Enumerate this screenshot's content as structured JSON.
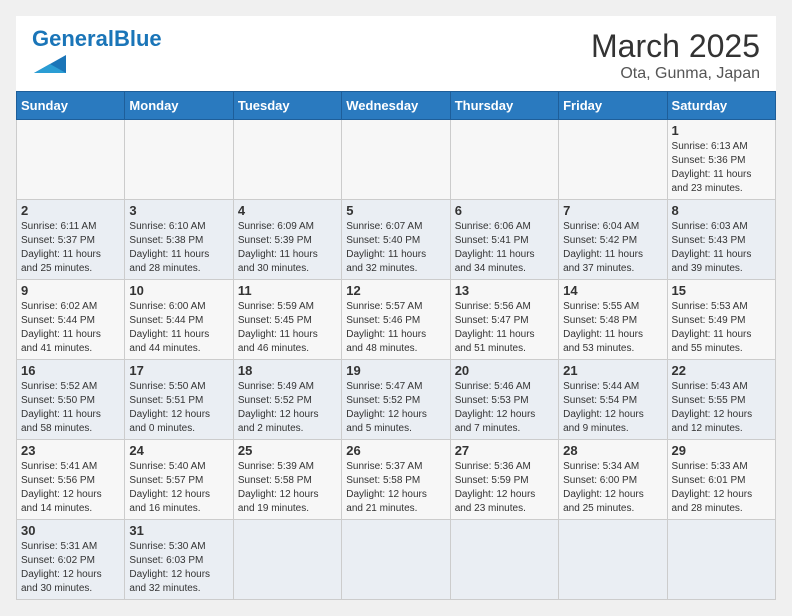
{
  "header": {
    "logo_general": "General",
    "logo_blue": "Blue",
    "month_year": "March 2025",
    "location": "Ota, Gunma, Japan"
  },
  "weekdays": [
    "Sunday",
    "Monday",
    "Tuesday",
    "Wednesday",
    "Thursday",
    "Friday",
    "Saturday"
  ],
  "days": [
    {
      "date": "",
      "info": ""
    },
    {
      "date": "",
      "info": ""
    },
    {
      "date": "",
      "info": ""
    },
    {
      "date": "",
      "info": ""
    },
    {
      "date": "",
      "info": ""
    },
    {
      "date": "",
      "info": ""
    },
    {
      "date": "1",
      "info": "Sunrise: 6:13 AM\nSunset: 5:36 PM\nDaylight: 11 hours\nand 23 minutes."
    },
    {
      "date": "2",
      "info": "Sunrise: 6:11 AM\nSunset: 5:37 PM\nDaylight: 11 hours\nand 25 minutes."
    },
    {
      "date": "3",
      "info": "Sunrise: 6:10 AM\nSunset: 5:38 PM\nDaylight: 11 hours\nand 28 minutes."
    },
    {
      "date": "4",
      "info": "Sunrise: 6:09 AM\nSunset: 5:39 PM\nDaylight: 11 hours\nand 30 minutes."
    },
    {
      "date": "5",
      "info": "Sunrise: 6:07 AM\nSunset: 5:40 PM\nDaylight: 11 hours\nand 32 minutes."
    },
    {
      "date": "6",
      "info": "Sunrise: 6:06 AM\nSunset: 5:41 PM\nDaylight: 11 hours\nand 34 minutes."
    },
    {
      "date": "7",
      "info": "Sunrise: 6:04 AM\nSunset: 5:42 PM\nDaylight: 11 hours\nand 37 minutes."
    },
    {
      "date": "8",
      "info": "Sunrise: 6:03 AM\nSunset: 5:43 PM\nDaylight: 11 hours\nand 39 minutes."
    },
    {
      "date": "9",
      "info": "Sunrise: 6:02 AM\nSunset: 5:44 PM\nDaylight: 11 hours\nand 41 minutes."
    },
    {
      "date": "10",
      "info": "Sunrise: 6:00 AM\nSunset: 5:44 PM\nDaylight: 11 hours\nand 44 minutes."
    },
    {
      "date": "11",
      "info": "Sunrise: 5:59 AM\nSunset: 5:45 PM\nDaylight: 11 hours\nand 46 minutes."
    },
    {
      "date": "12",
      "info": "Sunrise: 5:57 AM\nSunset: 5:46 PM\nDaylight: 11 hours\nand 48 minutes."
    },
    {
      "date": "13",
      "info": "Sunrise: 5:56 AM\nSunset: 5:47 PM\nDaylight: 11 hours\nand 51 minutes."
    },
    {
      "date": "14",
      "info": "Sunrise: 5:55 AM\nSunset: 5:48 PM\nDaylight: 11 hours\nand 53 minutes."
    },
    {
      "date": "15",
      "info": "Sunrise: 5:53 AM\nSunset: 5:49 PM\nDaylight: 11 hours\nand 55 minutes."
    },
    {
      "date": "16",
      "info": "Sunrise: 5:52 AM\nSunset: 5:50 PM\nDaylight: 11 hours\nand 58 minutes."
    },
    {
      "date": "17",
      "info": "Sunrise: 5:50 AM\nSunset: 5:51 PM\nDaylight: 12 hours\nand 0 minutes."
    },
    {
      "date": "18",
      "info": "Sunrise: 5:49 AM\nSunset: 5:52 PM\nDaylight: 12 hours\nand 2 minutes."
    },
    {
      "date": "19",
      "info": "Sunrise: 5:47 AM\nSunset: 5:52 PM\nDaylight: 12 hours\nand 5 minutes."
    },
    {
      "date": "20",
      "info": "Sunrise: 5:46 AM\nSunset: 5:53 PM\nDaylight: 12 hours\nand 7 minutes."
    },
    {
      "date": "21",
      "info": "Sunrise: 5:44 AM\nSunset: 5:54 PM\nDaylight: 12 hours\nand 9 minutes."
    },
    {
      "date": "22",
      "info": "Sunrise: 5:43 AM\nSunset: 5:55 PM\nDaylight: 12 hours\nand 12 minutes."
    },
    {
      "date": "23",
      "info": "Sunrise: 5:41 AM\nSunset: 5:56 PM\nDaylight: 12 hours\nand 14 minutes."
    },
    {
      "date": "24",
      "info": "Sunrise: 5:40 AM\nSunset: 5:57 PM\nDaylight: 12 hours\nand 16 minutes."
    },
    {
      "date": "25",
      "info": "Sunrise: 5:39 AM\nSunset: 5:58 PM\nDaylight: 12 hours\nand 19 minutes."
    },
    {
      "date": "26",
      "info": "Sunrise: 5:37 AM\nSunset: 5:58 PM\nDaylight: 12 hours\nand 21 minutes."
    },
    {
      "date": "27",
      "info": "Sunrise: 5:36 AM\nSunset: 5:59 PM\nDaylight: 12 hours\nand 23 minutes."
    },
    {
      "date": "28",
      "info": "Sunrise: 5:34 AM\nSunset: 6:00 PM\nDaylight: 12 hours\nand 25 minutes."
    },
    {
      "date": "29",
      "info": "Sunrise: 5:33 AM\nSunset: 6:01 PM\nDaylight: 12 hours\nand 28 minutes."
    },
    {
      "date": "30",
      "info": "Sunrise: 5:31 AM\nSunset: 6:02 PM\nDaylight: 12 hours\nand 30 minutes."
    },
    {
      "date": "31",
      "info": "Sunrise: 5:30 AM\nSunset: 6:03 PM\nDaylight: 12 hours\nand 32 minutes."
    },
    {
      "date": "",
      "info": ""
    },
    {
      "date": "",
      "info": ""
    },
    {
      "date": "",
      "info": ""
    },
    {
      "date": "",
      "info": ""
    },
    {
      "date": "",
      "info": ""
    }
  ]
}
